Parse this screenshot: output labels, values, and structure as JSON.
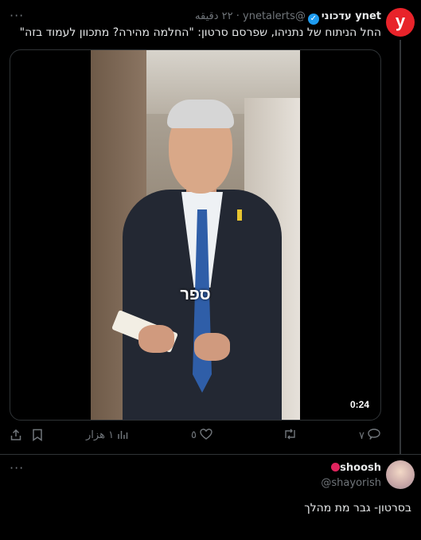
{
  "tweet": {
    "author_name": "ynet עדכוני",
    "handle": "@ynetalerts",
    "time": "٢٢ دقيقه",
    "avatar_letter": "y",
    "text": "החל הניתוח של נתניהו, שפרסם סרטון: \"החלמה מהירה? מתכוון לעמוד בזה\"",
    "media": {
      "caption": "ספר",
      "duration": "0:24"
    },
    "actions": {
      "replies": "٧",
      "reposts": "",
      "likes": "٥",
      "views": "١ هزار"
    },
    "more_glyph": "···"
  },
  "reply": {
    "author_name": "shoosh",
    "handle": "@shayorish",
    "text": "בסרטון- גבר מת מהלך",
    "more_glyph": "···"
  },
  "colors": {
    "background": "#000000",
    "text": "#e7e9ea",
    "muted": "#71767b",
    "verified": "#1d9bf0",
    "ynet_red": "#e8232a",
    "divider": "#2f3336"
  }
}
